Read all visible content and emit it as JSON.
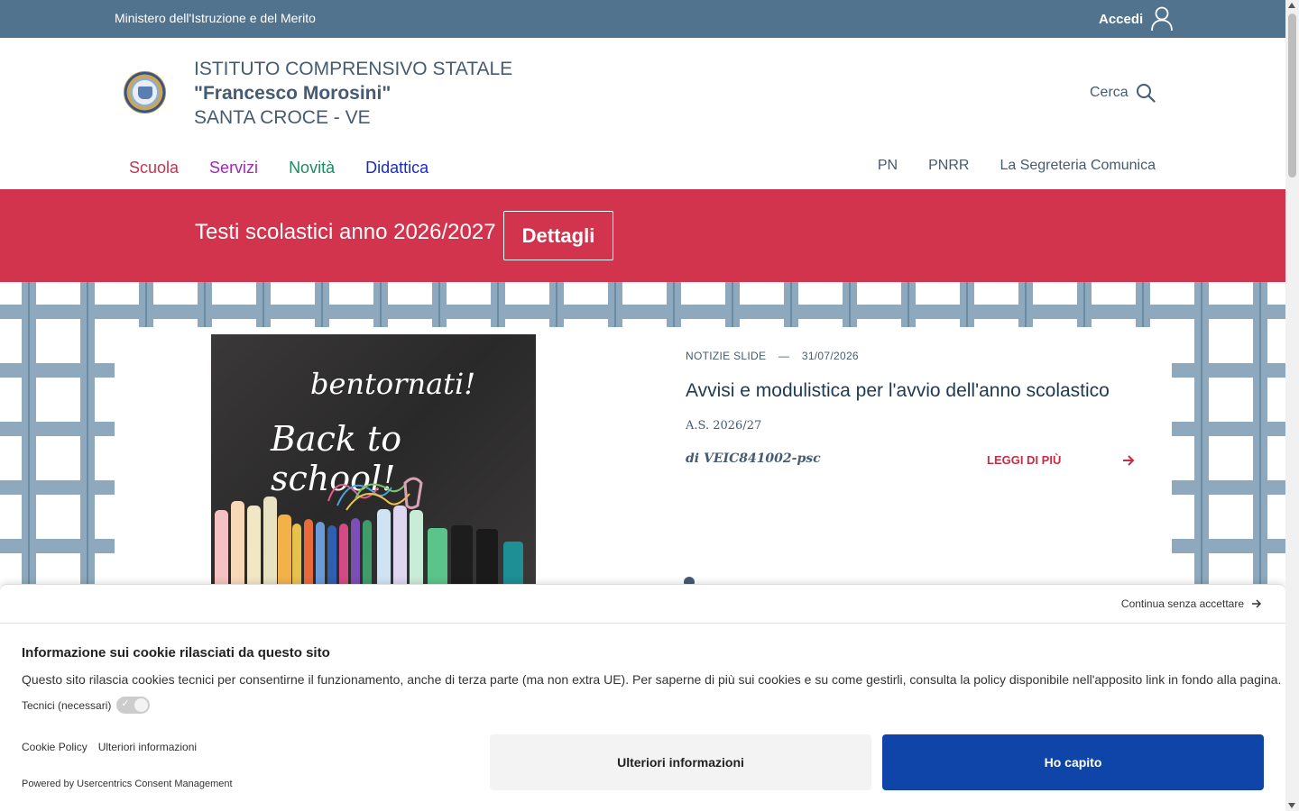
{
  "topbar": {
    "ministry": "Ministero dell'Istruzione e del Merito",
    "login_label": "Accedi"
  },
  "header": {
    "line1": "ISTITUTO COMPRENSIVO STATALE",
    "line2": "\"Francesco Morosini\"",
    "line3": "SANTA CROCE - VE",
    "search_label": "Cerca"
  },
  "nav": {
    "main": [
      {
        "label": "Scuola",
        "color": "#c73350"
      },
      {
        "label": "Servizi",
        "color": "#a227b8"
      },
      {
        "label": "Novità",
        "color": "#1e8a5e"
      },
      {
        "label": "Didattica",
        "color": "#1a2ad1"
      }
    ],
    "secondary": [
      "PN",
      "PNRR",
      "La Segreteria Comunica"
    ]
  },
  "banner": {
    "text": "Testi scolastici anno 2026/2027",
    "button": "Dettagli",
    "color": "#d1344c"
  },
  "slide": {
    "image_text1": "bentornati!",
    "image_text2": "Back to school!",
    "category": "NOTIZIE SLIDE",
    "separator": "—",
    "date": "31/07/2026",
    "title": "Avvisi e modulistica per l'avvio dell'anno scolastico",
    "subtitle": "A.S. 2026/27",
    "author": "di VEIC841002-psc",
    "more_label": "LEGGI DI PIÙ"
  },
  "cookie": {
    "continue_label": "Continua senza accettare",
    "title": "Informazione sui cookie rilasciati da questo sito",
    "description": "Questo sito rilascia cookies tecnici per consentirne il funzionamento, anche di terza parte (ma non extra UE). Per saperne di più sui cookies e su come gestirli, consulta la policy disponibile nell'apposito link in fondo alla pagina.",
    "technical_label": "Tecnici (necessari)",
    "link_policy": "Cookie Policy",
    "link_info": "Ulteriori informazioni",
    "powered": "Powered by Usercentrics Consent Management",
    "btn_more": "Ulteriori informazioni",
    "btn_ok": "Ho capito",
    "accent": "#0f45a8"
  }
}
